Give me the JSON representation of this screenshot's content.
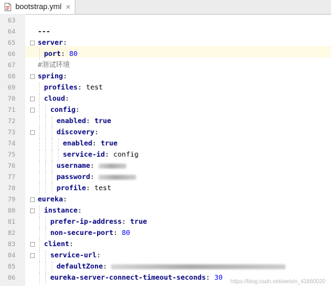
{
  "tab": {
    "filename": "bootstrap.yml",
    "file_icon": "yaml-file-icon",
    "close_glyph": "×"
  },
  "lines": [
    {
      "n": "63",
      "indent": 0,
      "parts": []
    },
    {
      "n": "64",
      "indent": 0,
      "parts": [
        {
          "t": "---",
          "c": "doc"
        }
      ]
    },
    {
      "n": "65",
      "indent": 0,
      "fold": true,
      "parts": [
        {
          "t": "server",
          "c": "key"
        },
        {
          "t": ":",
          "c": "colon"
        }
      ]
    },
    {
      "n": "66",
      "indent": 1,
      "parts": [
        {
          "t": "port",
          "c": "key"
        },
        {
          "t": ": ",
          "c": "colon"
        },
        {
          "t": "80",
          "c": "num"
        }
      ]
    },
    {
      "n": "67",
      "indent": 0,
      "parts": [
        {
          "t": "#测试环境",
          "c": "cmt"
        }
      ]
    },
    {
      "n": "68",
      "indent": 0,
      "fold": true,
      "parts": [
        {
          "t": "spring",
          "c": "key"
        },
        {
          "t": ":",
          "c": "colon"
        }
      ]
    },
    {
      "n": "69",
      "indent": 1,
      "parts": [
        {
          "t": "profiles",
          "c": "key"
        },
        {
          "t": ": ",
          "c": "colon"
        },
        {
          "t": "test",
          "c": "str"
        }
      ]
    },
    {
      "n": "70",
      "indent": 1,
      "fold": true,
      "parts": [
        {
          "t": "cloud",
          "c": "key"
        },
        {
          "t": ":",
          "c": "colon"
        }
      ]
    },
    {
      "n": "71",
      "indent": 2,
      "fold": true,
      "parts": [
        {
          "t": "config",
          "c": "key"
        },
        {
          "t": ":",
          "c": "colon"
        }
      ]
    },
    {
      "n": "72",
      "indent": 3,
      "parts": [
        {
          "t": "enabled",
          "c": "key"
        },
        {
          "t": ": ",
          "c": "colon"
        },
        {
          "t": "true",
          "c": "kw"
        }
      ]
    },
    {
      "n": "73",
      "indent": 3,
      "fold": true,
      "parts": [
        {
          "t": "discovery",
          "c": "key"
        },
        {
          "t": ":",
          "c": "colon"
        }
      ]
    },
    {
      "n": "74",
      "indent": 4,
      "parts": [
        {
          "t": "enabled",
          "c": "key"
        },
        {
          "t": ": ",
          "c": "colon"
        },
        {
          "t": "true",
          "c": "kw"
        }
      ]
    },
    {
      "n": "75",
      "indent": 4,
      "parts": [
        {
          "t": "service-id",
          "c": "key"
        },
        {
          "t": ": ",
          "c": "colon"
        },
        {
          "t": "config",
          "c": "str"
        }
      ]
    },
    {
      "n": "76",
      "indent": 3,
      "parts": [
        {
          "t": "username",
          "c": "key"
        },
        {
          "t": ": ",
          "c": "colon"
        }
      ],
      "blur": 40
    },
    {
      "n": "77",
      "indent": 3,
      "parts": [
        {
          "t": "password",
          "c": "key"
        },
        {
          "t": ": ",
          "c": "colon"
        }
      ],
      "blur": 54
    },
    {
      "n": "78",
      "indent": 3,
      "parts": [
        {
          "t": "profile",
          "c": "key"
        },
        {
          "t": ": ",
          "c": "colon"
        },
        {
          "t": "test",
          "c": "str"
        }
      ]
    },
    {
      "n": "79",
      "indent": 0,
      "fold": true,
      "parts": [
        {
          "t": "eureka",
          "c": "key"
        },
        {
          "t": ":",
          "c": "colon"
        }
      ]
    },
    {
      "n": "80",
      "indent": 1,
      "fold": true,
      "parts": [
        {
          "t": "instance",
          "c": "key"
        },
        {
          "t": ":",
          "c": "colon"
        }
      ]
    },
    {
      "n": "81",
      "indent": 2,
      "parts": [
        {
          "t": "prefer-ip-address",
          "c": "key"
        },
        {
          "t": ": ",
          "c": "colon"
        },
        {
          "t": "true",
          "c": "kw"
        }
      ]
    },
    {
      "n": "82",
      "indent": 2,
      "parts": [
        {
          "t": "non-secure-port",
          "c": "key"
        },
        {
          "t": ": ",
          "c": "colon"
        },
        {
          "t": "80",
          "c": "num"
        }
      ]
    },
    {
      "n": "83",
      "indent": 1,
      "fold": true,
      "parts": [
        {
          "t": "client",
          "c": "key"
        },
        {
          "t": ":",
          "c": "colon"
        }
      ]
    },
    {
      "n": "84",
      "indent": 2,
      "fold": true,
      "parts": [
        {
          "t": "service-url",
          "c": "key"
        },
        {
          "t": ":",
          "c": "colon"
        }
      ]
    },
    {
      "n": "85",
      "indent": 3,
      "parts": [
        {
          "t": "defaultZone",
          "c": "key"
        },
        {
          "t": ": ",
          "c": "colon"
        }
      ],
      "blur": 250
    },
    {
      "n": "86",
      "indent": 2,
      "parts": [
        {
          "t": "eureka-server-connect-timeout-seconds",
          "c": "key"
        },
        {
          "t": ": ",
          "c": "colon"
        },
        {
          "t": "30",
          "c": "num"
        }
      ]
    }
  ],
  "watermark": "https://blog.csdn.net/weixin_41660020"
}
